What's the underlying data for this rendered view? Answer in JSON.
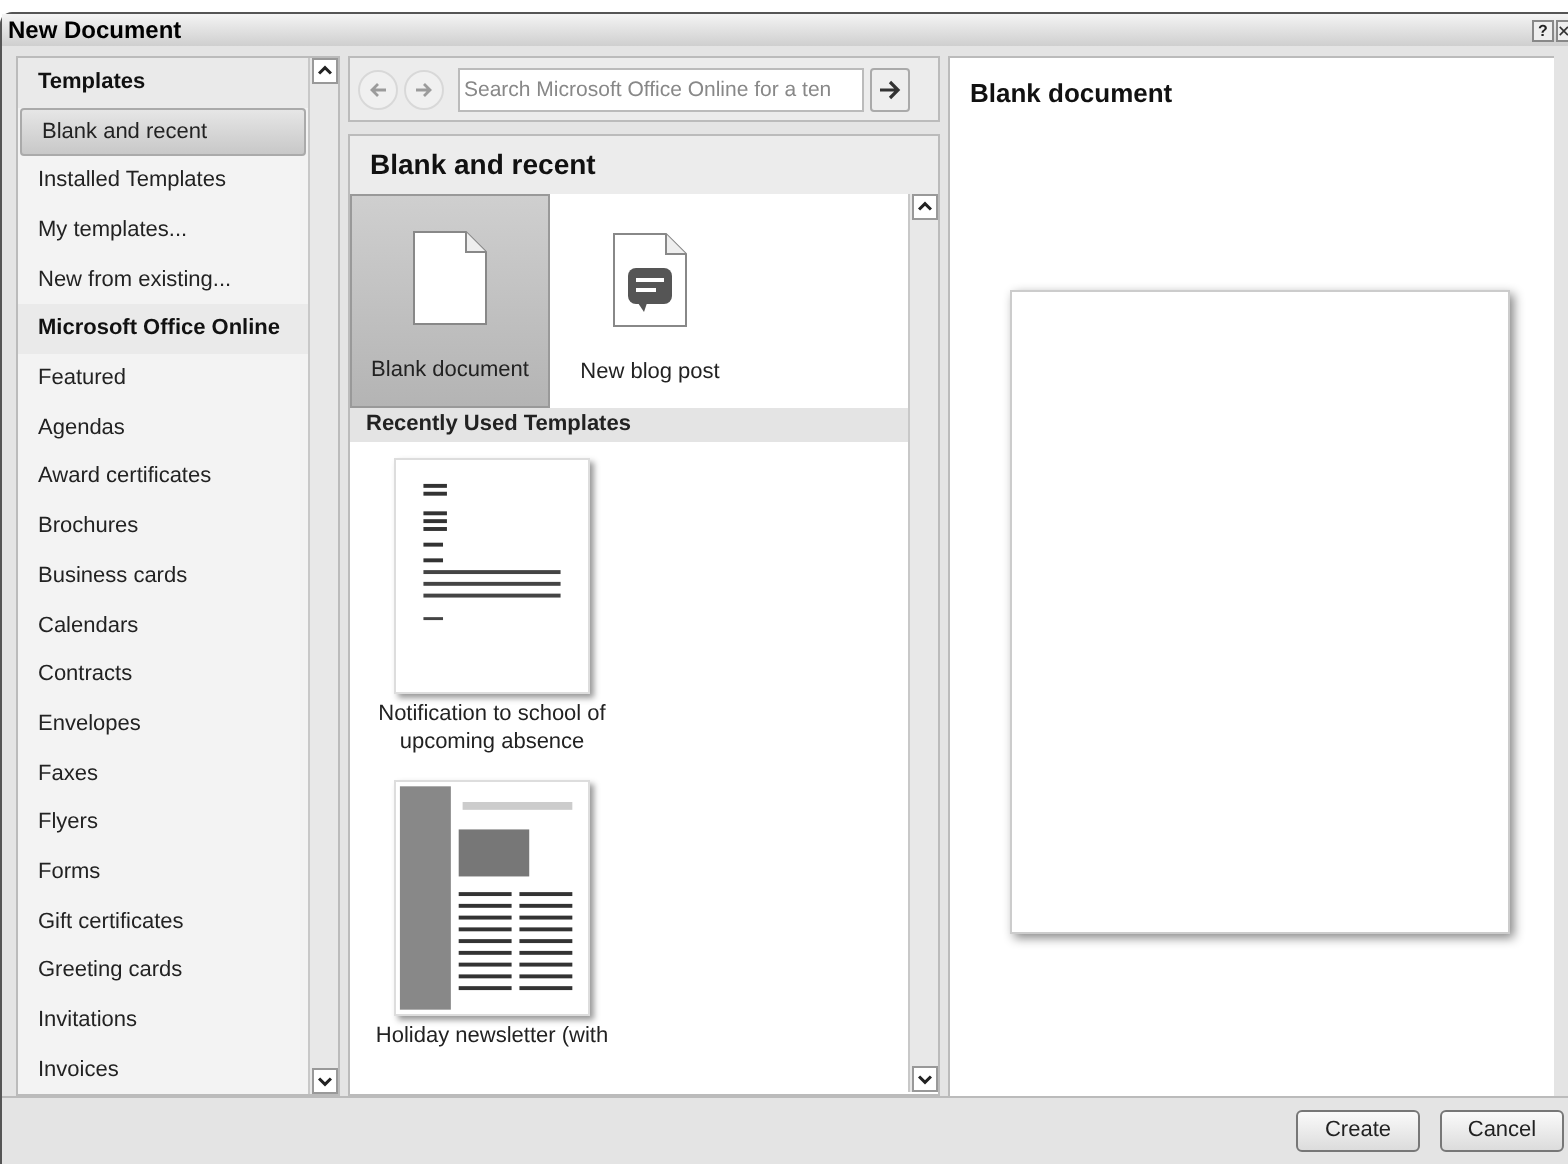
{
  "window": {
    "title": "New Document",
    "title_buttons": [
      "?"
    ]
  },
  "sidebar": {
    "items": [
      {
        "kind": "header",
        "label": "Templates",
        "selected": false
      },
      {
        "kind": "item",
        "label": "Blank and recent",
        "selected": true
      },
      {
        "kind": "item",
        "label": "Installed Templates",
        "selected": false
      },
      {
        "kind": "item",
        "label": "My templates...",
        "selected": false
      },
      {
        "kind": "item",
        "label": "New from existing...",
        "selected": false
      },
      {
        "kind": "header",
        "label": "Microsoft Office Online",
        "selected": false
      },
      {
        "kind": "item",
        "label": "Featured",
        "selected": false
      },
      {
        "kind": "item",
        "label": "Agendas",
        "selected": false
      },
      {
        "kind": "item",
        "label": "Award certificates",
        "selected": false
      },
      {
        "kind": "item",
        "label": "Brochures",
        "selected": false
      },
      {
        "kind": "item",
        "label": "Business cards",
        "selected": false
      },
      {
        "kind": "item",
        "label": "Calendars",
        "selected": false
      },
      {
        "kind": "item",
        "label": "Contracts",
        "selected": false
      },
      {
        "kind": "item",
        "label": "Envelopes",
        "selected": false
      },
      {
        "kind": "item",
        "label": "Faxes",
        "selected": false
      },
      {
        "kind": "item",
        "label": "Flyers",
        "selected": false
      },
      {
        "kind": "item",
        "label": "Forms",
        "selected": false
      },
      {
        "kind": "item",
        "label": "Gift certificates",
        "selected": false
      },
      {
        "kind": "item",
        "label": "Greeting cards",
        "selected": false
      },
      {
        "kind": "item",
        "label": "Invitations",
        "selected": false
      },
      {
        "kind": "item",
        "label": "Invoices",
        "selected": false
      }
    ]
  },
  "toolbar": {
    "nav_buttons": [
      {
        "kind": "back",
        "disabled": true
      },
      {
        "kind": "forward",
        "disabled": true
      }
    ],
    "search": {
      "placeholder": "Search Microsoft Office Online for a ten"
    }
  },
  "gallery": {
    "heading": "Blank and recent",
    "tiles": [
      {
        "kind": "blank",
        "label": "Blank document",
        "selected": true
      },
      {
        "kind": "blog",
        "label": "New blog post",
        "selected": false
      }
    ],
    "section": "Recently Used Templates",
    "recent": [
      {
        "kind": "letter",
        "label": "Notification to school of upcoming absence"
      },
      {
        "kind": "newsletter",
        "label": "Holiday newsletter (with"
      }
    ]
  },
  "preview": {
    "title": "Blank document"
  },
  "buttons": [
    {
      "label": "Create"
    },
    {
      "label": "Cancel"
    }
  ]
}
